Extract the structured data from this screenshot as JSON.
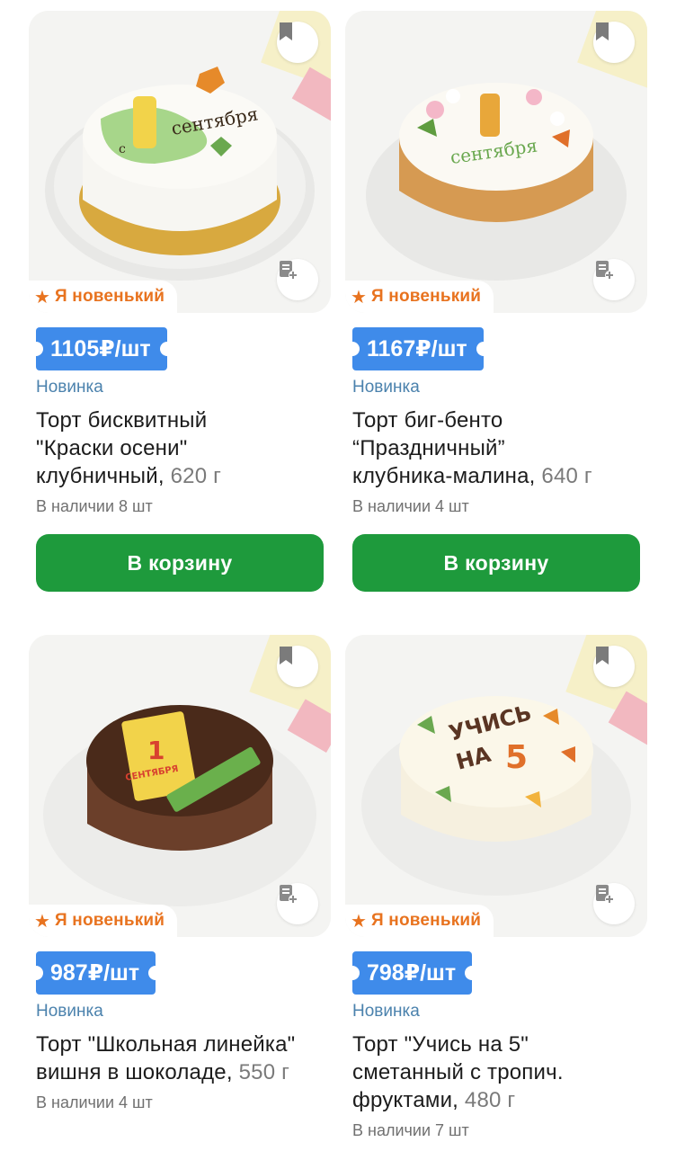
{
  "colors": {
    "price_bg": "#3f8bea",
    "cart_bg": "#1e9a3c",
    "badge_text": "#e8731f",
    "new_text": "#4b82ad"
  },
  "products": [
    {
      "badge": "Я новенький",
      "price": "1105₽/шт",
      "tag": "Новинка",
      "title_lines": [
        "Торт бисквитный",
        "\"Краски осени\"",
        "клубничный,"
      ],
      "weight": "620 г",
      "stock": "В наличии 8 шт",
      "cart": "В корзину",
      "icon": "cake-photo-1-september"
    },
    {
      "badge": "Я новенький",
      "price": "1167₽/шт",
      "tag": "Новинка",
      "title_lines": [
        "Торт биг-бенто",
        "“Праздничный”",
        "клубника-малина,"
      ],
      "weight": "640 г",
      "stock": "В наличии 4 шт",
      "cart": "В корзину",
      "icon": "cake-photo-nuts"
    },
    {
      "badge": "Я новенький",
      "price": "987₽/шт",
      "tag": "Новинка",
      "title_lines": [
        "Торт \"Школьная линейка\"",
        "вишня в шоколаде,"
      ],
      "weight": "550 г",
      "stock": "В наличии 4 шт",
      "cart": "",
      "icon": "cake-photo-chocolate"
    },
    {
      "badge": "Я новенький",
      "price": "798₽/шт",
      "tag": "Новинка",
      "title_lines": [
        "Торт \"Учись на 5\"",
        "сметанный с тропич.",
        "фруктами,"
      ],
      "weight": "480 г",
      "stock": "В наличии 7 шт",
      "cart": "",
      "icon": "cake-photo-study"
    }
  ],
  "cake_text": {
    "c0_line1": "с",
    "c0_digit": "1",
    "c0_line2": "сентября",
    "c1_digit": "1",
    "c1_line": "сентября",
    "c2_digit": "1",
    "c2_line": "СЕНТЯБРЯ",
    "c3_line1": "УЧИСЬ",
    "c3_line2": "НА",
    "c3_digit": "5"
  }
}
